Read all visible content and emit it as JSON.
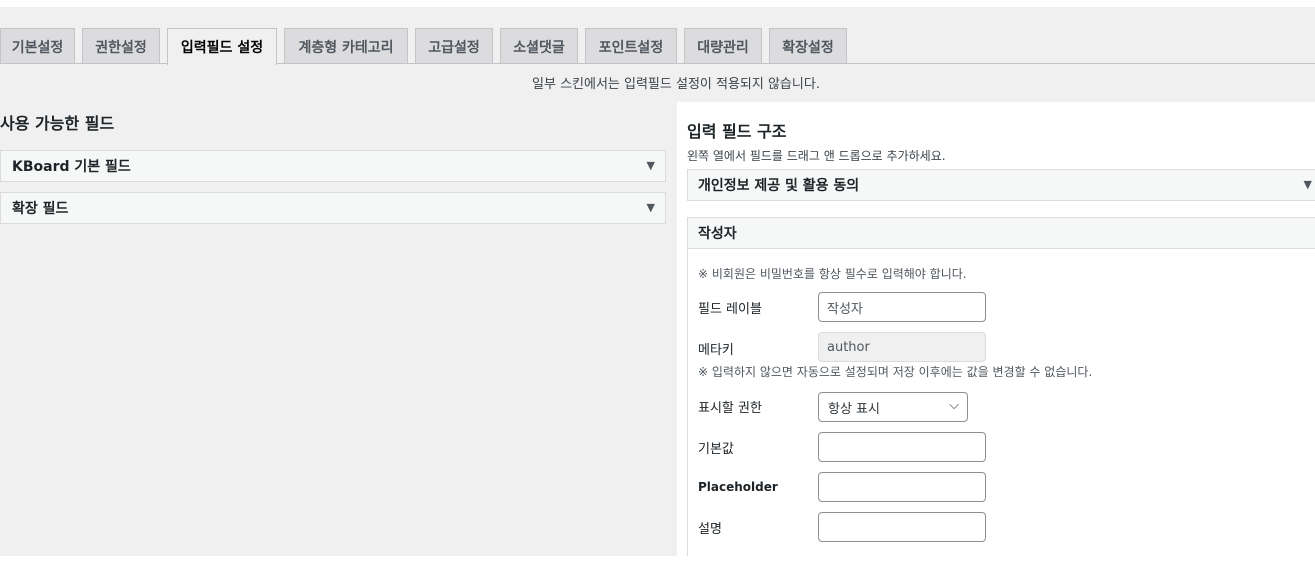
{
  "tabs": [
    {
      "label": "기본설정"
    },
    {
      "label": "권한설정"
    },
    {
      "label": "입력필드 설정"
    },
    {
      "label": "계층형 카테고리"
    },
    {
      "label": "고급설정"
    },
    {
      "label": "소셜댓글"
    },
    {
      "label": "포인트설정"
    },
    {
      "label": "대량관리"
    },
    {
      "label": "확장설정"
    }
  ],
  "active_tab": "입력필드 설정",
  "notice": "일부 스킨에서는 입력필드 설정이 적용되지 않습니다.",
  "left": {
    "title": "사용 가능한 필드",
    "sections": [
      {
        "label": "KBoard 기본 필드"
      },
      {
        "label": "확장 필드"
      }
    ]
  },
  "right": {
    "title": "입력 필드 구조",
    "subtitle": "왼쪽 열에서 필드를 드래그 앤 드롭으로 추가하세요.",
    "privacy_section": "개인정보 제공 및 활용 동의",
    "author_section": {
      "title": "작성자",
      "note_password": "※ 비회원은 비밀번호를 항상 필수로 입력해야 합니다.",
      "field_label_label": "필드 레이블",
      "field_label_value": "작성자",
      "meta_key_label": "메타키",
      "meta_key_value": "author",
      "note_meta": "※ 입력하지 않으면 자동으로 설정되며 저장 이후에는 값을 변경할 수 없습니다.",
      "permission_label": "표시할 권한",
      "permission_value": "항상 표시",
      "default_label": "기본값",
      "default_value": "",
      "placeholder_label": "Placeholder",
      "placeholder_value": "",
      "description_label": "설명",
      "description_value": ""
    }
  },
  "icons": {
    "collapse": "triangle-down",
    "select": "chevron-down"
  },
  "colors": {
    "background": "#f0f0f1",
    "tab_inactive": "#dcdcde",
    "border": "#c3c4c7"
  }
}
